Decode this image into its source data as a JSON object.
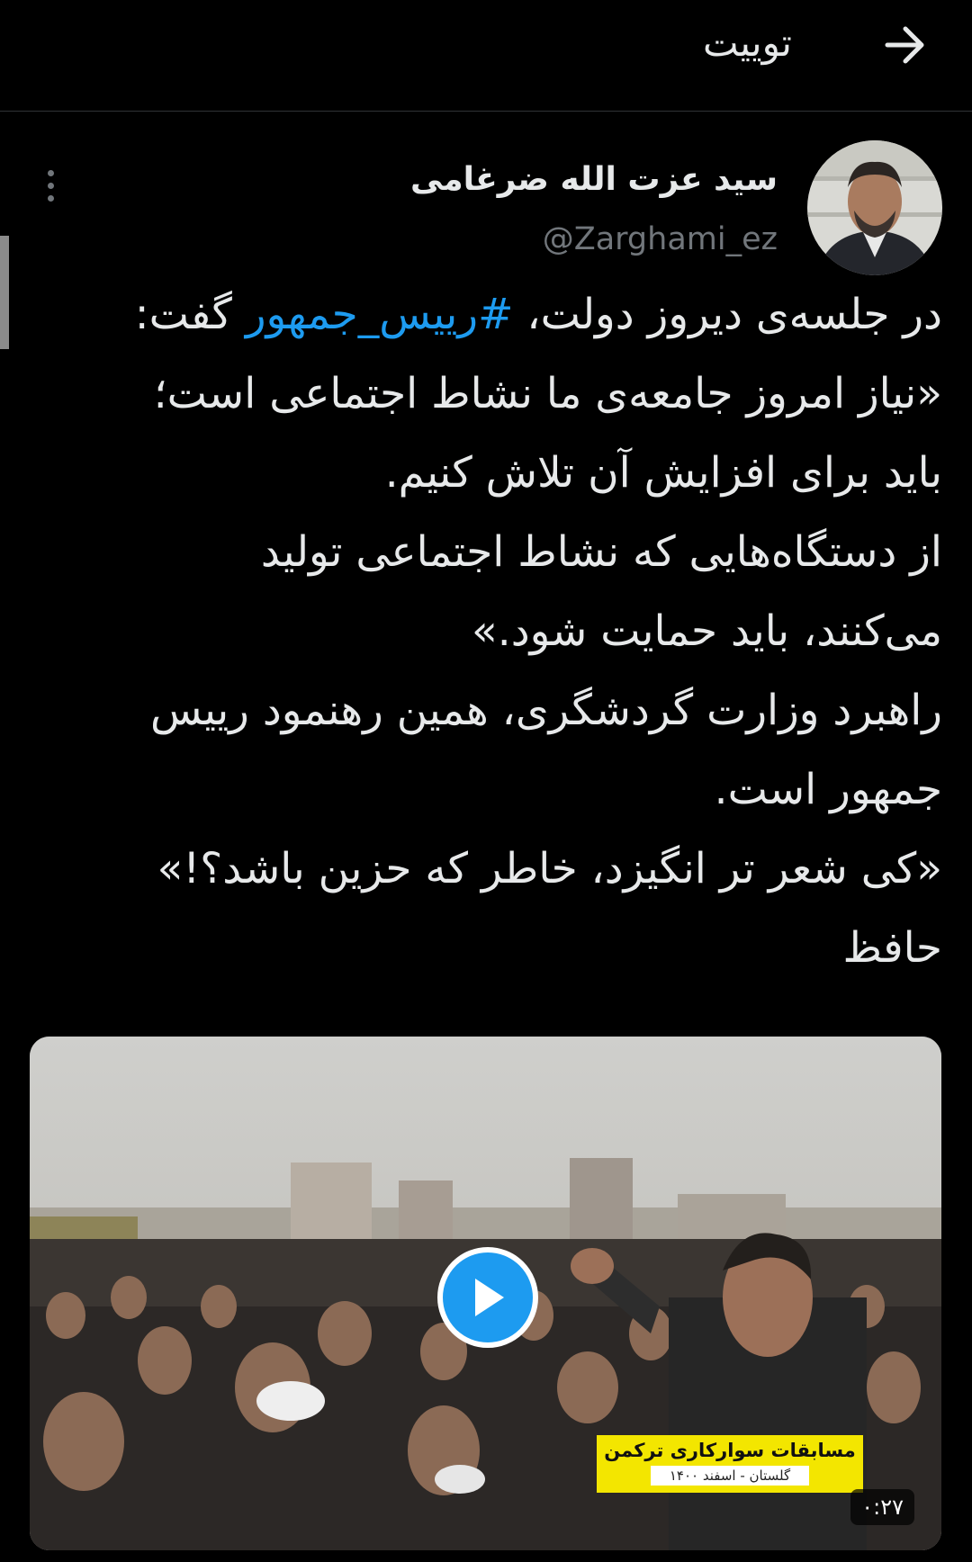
{
  "header": {
    "title": "توییت",
    "back_icon": "arrow-right-icon"
  },
  "author": {
    "name": "سید عزت الله ضرغامی",
    "handle": "@Zarghami_ez",
    "avatar_icon": "profile-photo"
  },
  "more_icon": "more-vertical-icon",
  "tweet": {
    "line1_pre": "در جلسه‌ی دیروز دولت، ",
    "hashtag": "#رییس_جمهور",
    "line1_post": " گفت:",
    "line2": "«نیاز امروز جامعه‌ی ما نشاط اجتماعی است؛",
    "line3": "باید برای افزایش آن تلاش کنیم.",
    "line4": "از دستگاه‌هایی که نشاط اجتماعی تولید",
    "line5": "می‌کنند، باید حمایت شود.»",
    "line6": "راهبرد وزارت گردشگری، همین رهنمود رییس",
    "line7": "جمهور است.",
    "line8": "«کی شعر تر انگیزد، خاطر که حزین باشد؟!»",
    "line9": "حافظ"
  },
  "media": {
    "type": "video",
    "play_icon": "play-icon",
    "caption_title": "مسابقات سوارکاری ترکمن",
    "caption_subtitle": "گلستان - اسفند ۱۴۰۰",
    "duration": "۰:۲۷",
    "colors": {
      "play": "#1d9bf0",
      "caption_bg": "#f3e600"
    }
  },
  "colors": {
    "background": "#000000",
    "text": "#e7e9ea",
    "muted": "#71767b",
    "link": "#1d9bf0"
  }
}
